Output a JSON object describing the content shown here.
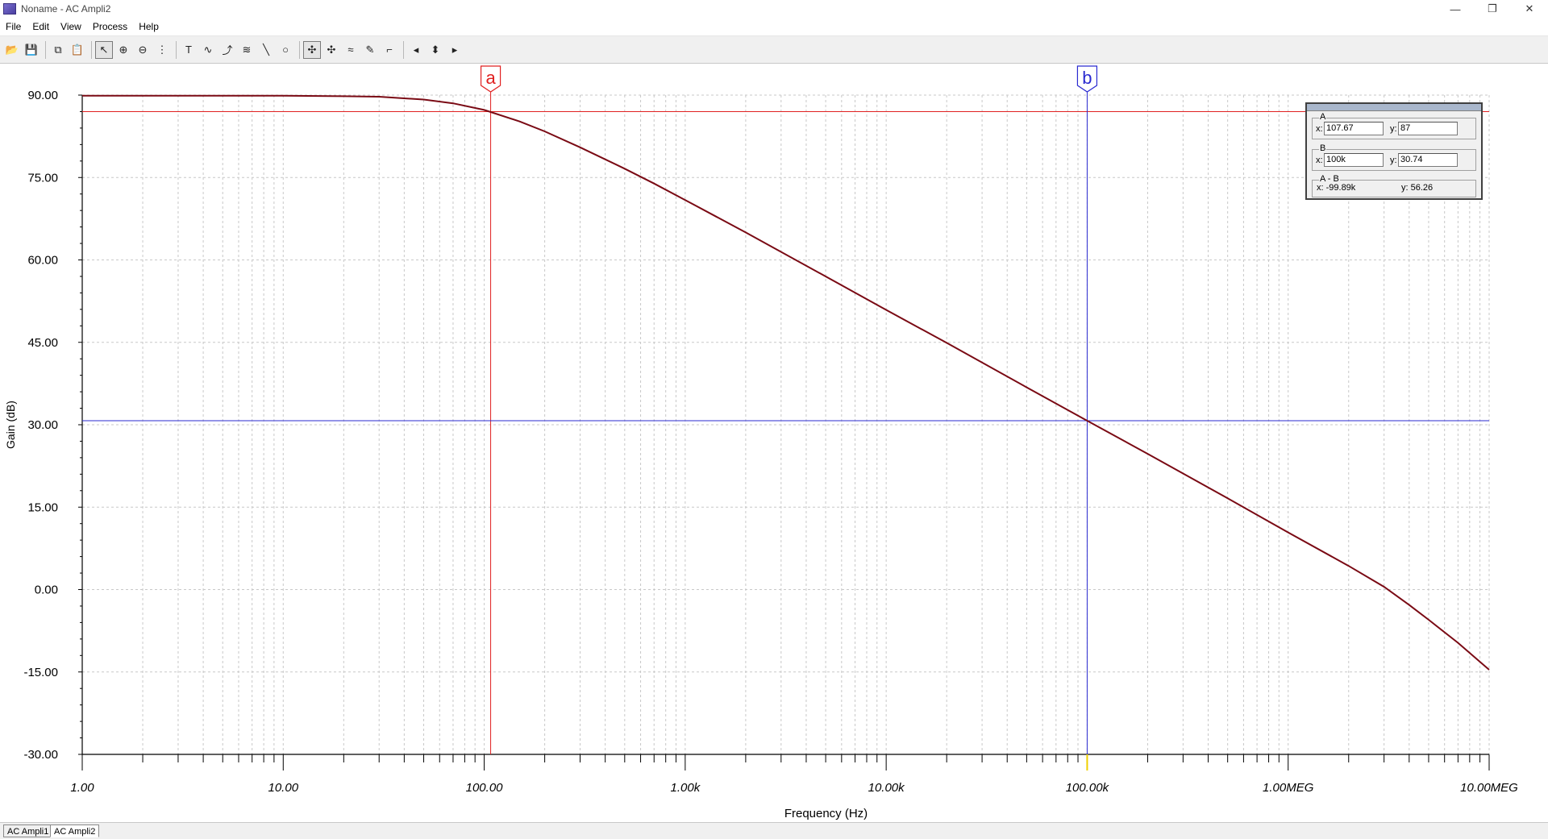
{
  "window": {
    "title": "Noname - AC Ampli2",
    "controls": [
      "—",
      "❐",
      "✕"
    ]
  },
  "menu": [
    "File",
    "Edit",
    "View",
    "Process",
    "Help"
  ],
  "toolbar": {
    "buttons": [
      {
        "name": "open-icon",
        "glyph": "📂"
      },
      {
        "name": "save-icon",
        "glyph": "💾"
      },
      {
        "sep": true
      },
      {
        "name": "copy-icon",
        "glyph": "⧉"
      },
      {
        "name": "paste-icon",
        "glyph": "📋"
      },
      {
        "sep": true
      },
      {
        "name": "pointer-icon",
        "glyph": "↖",
        "active": true
      },
      {
        "name": "zoom-in-icon",
        "glyph": "⊕"
      },
      {
        "name": "zoom-out-icon",
        "glyph": "⊖"
      },
      {
        "name": "grid-icon",
        "glyph": "⋮"
      },
      {
        "sep": true
      },
      {
        "name": "text-icon",
        "glyph": "T"
      },
      {
        "name": "curve-tool-icon",
        "glyph": "∿"
      },
      {
        "name": "curve-fit-icon",
        "glyph": "⤴"
      },
      {
        "name": "curve-label-icon",
        "glyph": "≋"
      },
      {
        "name": "line-tool-icon",
        "glyph": "╲"
      },
      {
        "name": "ellipse-tool-icon",
        "glyph": "○"
      },
      {
        "sep": true
      },
      {
        "name": "cursor-a-icon",
        "glyph": "✣",
        "active": true
      },
      {
        "name": "cursor-b-icon",
        "glyph": "✣"
      },
      {
        "name": "waveforms-icon",
        "glyph": "≈"
      },
      {
        "name": "marker-icon",
        "glyph": "✎"
      },
      {
        "name": "step-icon",
        "glyph": "⌐"
      },
      {
        "sep": true
      },
      {
        "name": "arrow-left-icon",
        "glyph": "◂"
      },
      {
        "name": "arrow-updown-icon",
        "glyph": "⬍"
      },
      {
        "name": "arrow-right-icon",
        "glyph": "▸"
      }
    ]
  },
  "cursor_panel": {
    "a": {
      "label": "A",
      "x_label": "x:",
      "x": "107.67",
      "y_label": "y:",
      "y": "87"
    },
    "b": {
      "label": "B",
      "x_label": "x:",
      "x": "100k",
      "y_label": "y:",
      "y": "30.74"
    },
    "diff": {
      "label": "A - B",
      "x_text": "x:  -99.89k",
      "y_text": "y: 56.26"
    }
  },
  "chart_data": {
    "type": "line",
    "xlabel": "Frequency (Hz)",
    "ylabel": "Gain (dB)",
    "xscale": "log",
    "xlim": [
      1,
      10000000
    ],
    "ylim": [
      -30,
      90
    ],
    "x_ticks": [
      {
        "value": 1,
        "label": "1.00"
      },
      {
        "value": 10,
        "label": "10.00"
      },
      {
        "value": 100,
        "label": "100.00"
      },
      {
        "value": 1000,
        "label": "1.00k"
      },
      {
        "value": 10000,
        "label": "10.00k"
      },
      {
        "value": 100000,
        "label": "100.00k"
      },
      {
        "value": 1000000,
        "label": "1.00MEG"
      },
      {
        "value": 10000000,
        "label": "10.00MEG"
      }
    ],
    "y_ticks": [
      {
        "value": 90,
        "label": "90.00"
      },
      {
        "value": 75,
        "label": "75.00"
      },
      {
        "value": 60,
        "label": "60.00"
      },
      {
        "value": 45,
        "label": "45.00"
      },
      {
        "value": 30,
        "label": "30.00"
      },
      {
        "value": 15,
        "label": "15.00"
      },
      {
        "value": 0,
        "label": "0.00"
      },
      {
        "value": -15,
        "label": "-15.00"
      },
      {
        "value": -30,
        "label": "-30.00"
      }
    ],
    "grid": true,
    "series": [
      {
        "color": "#7a0a14",
        "points": [
          [
            1,
            89.9
          ],
          [
            3,
            89.9
          ],
          [
            10,
            89.9
          ],
          [
            20,
            89.8
          ],
          [
            30,
            89.7
          ],
          [
            50,
            89.2
          ],
          [
            70,
            88.5
          ],
          [
            100,
            87.3
          ],
          [
            150,
            85.2
          ],
          [
            200,
            83.4
          ],
          [
            300,
            80.5
          ],
          [
            500,
            76.6
          ],
          [
            700,
            73.9
          ],
          [
            1000,
            70.9
          ],
          [
            2000,
            65.0
          ],
          [
            5000,
            57.0
          ],
          [
            10000,
            50.9
          ],
          [
            20000,
            44.9
          ],
          [
            50000,
            36.8
          ],
          [
            100000,
            30.74
          ],
          [
            200000,
            24.7
          ],
          [
            500000,
            16.6
          ],
          [
            1000000,
            10.4
          ],
          [
            2000000,
            4.3
          ],
          [
            3000000,
            0.5
          ],
          [
            4000000,
            -2.8
          ],
          [
            5000000,
            -5.5
          ],
          [
            7000000,
            -9.7
          ],
          [
            10000000,
            -14.6
          ]
        ]
      }
    ],
    "cursors": [
      {
        "label": "a",
        "x": 107.67,
        "y": 87,
        "color": "#e02020"
      },
      {
        "label": "b",
        "x": 100000,
        "y": 30.74,
        "color": "#2a2ad0"
      }
    ]
  },
  "tabs": [
    {
      "label": "AC Ampli1",
      "active": false
    },
    {
      "label": "AC Ampli2",
      "active": true
    }
  ]
}
